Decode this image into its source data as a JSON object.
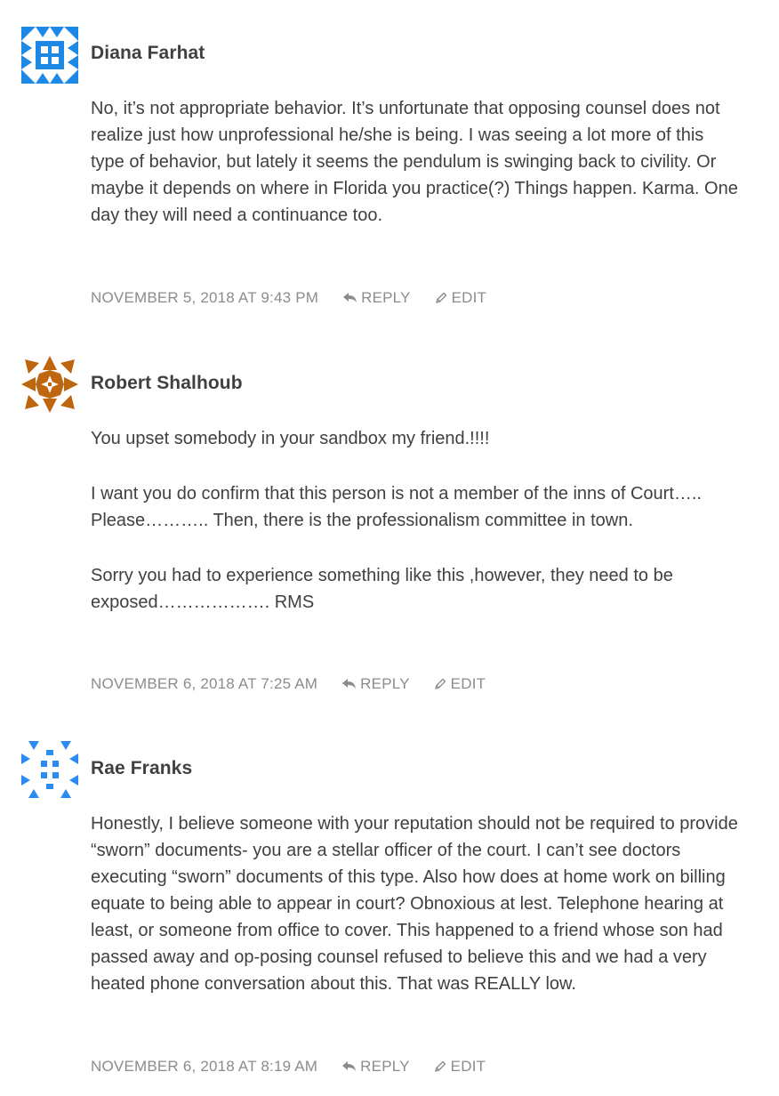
{
  "comments": [
    {
      "author": "Diana Farhat",
      "avatar_icon": "identicon-blue-grid",
      "avatar_color": "#1e88e5",
      "paragraphs": [
        "No, it’s not appropriate behavior. It’s unfortunate that opposing counsel does not realize just how unprofessional he/she is being. I was seeing a lot more of this type of behavior, but lately it seems the pendulum is swinging back to civility. Or maybe it depends on where in Florida you practice(?) Things happen. Karma. One day they will need a continuance too."
      ],
      "date": "November 5, 2018 at 9:43 pm",
      "reply_label": "Reply",
      "edit_label": "Edit"
    },
    {
      "author": "Robert Shalhoub",
      "avatar_icon": "identicon-orange-star",
      "avatar_color": "#c0650f",
      "paragraphs": [
        "You upset somebody in your sandbox my friend.!!!!",
        "I want you do confirm that this person is not a member of the inns of Court….. Please……….. Then, there is the professionalism committee in town.",
        "Sorry you had to experience something like this ,however, they need to be exposed………………. RMS"
      ],
      "date": "November 6, 2018 at 7:25 am",
      "reply_label": "Reply",
      "edit_label": "Edit"
    },
    {
      "author": "Rae Franks",
      "avatar_icon": "identicon-blue-dots",
      "avatar_color": "#2a8cf0",
      "paragraphs": [
        "Honestly, I believe someone with your reputation should not be required to provide “sworn” documents- you are a stellar officer of the court. I can’t see doctors executing “sworn” documents of this type. Also how does at home work on billing equate to being able to appear in court? Obnoxious at lest. Telephone hearing at least, or someone from office to cover. This happened to a friend whose son had passed away and op-posing counsel refused to believe this and we had a very heated phone conversation about this. That was REALLY low."
      ],
      "date": "November 6, 2018 at 8:19 am",
      "reply_label": "Reply",
      "edit_label": "Edit"
    }
  ]
}
